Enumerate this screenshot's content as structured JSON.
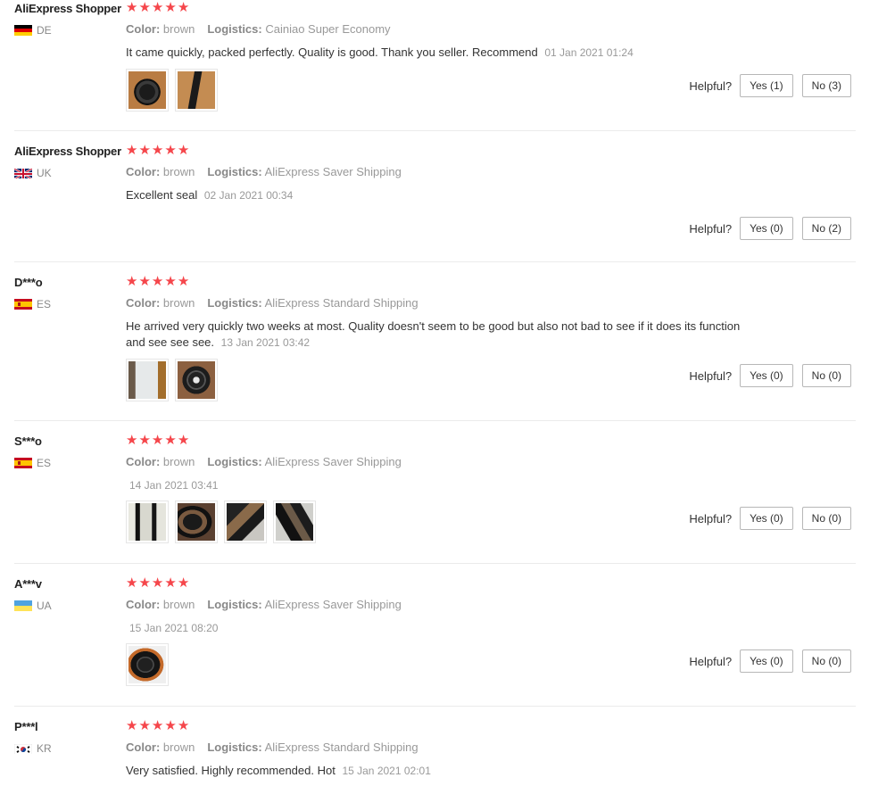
{
  "labels": {
    "color": "Color:",
    "logistics": "Logistics:",
    "helpful": "Helpful?"
  },
  "colors": {
    "star": "#f5464b",
    "text_muted": "#999999"
  },
  "reviews": [
    {
      "user": "AliExpress Shopper",
      "country": "DE",
      "flag": "de-flag-icon",
      "rating": 5,
      "color": "brown",
      "logistics": "Cainiao Super Economy",
      "text": "It came quickly, packed perfectly. Quality is good. Thank you seller. Recommend",
      "date": "01 Jan 2021 01:24",
      "photos": [
        "photo-brown-seal-rolled",
        "photo-brown-seal-strip"
      ],
      "yes": "Yes (1)",
      "no": "No (3)"
    },
    {
      "user": "AliExpress Shopper",
      "country": "UK",
      "flag": "uk-flag-icon",
      "rating": 5,
      "color": "brown",
      "logistics": "AliExpress Saver Shipping",
      "text": "Excellent seal",
      "date": "02 Jan 2021 00:34",
      "photos": [],
      "yes": "Yes (0)",
      "no": "No (2)"
    },
    {
      "user": "D***o",
      "country": "ES",
      "flag": "es-flag-icon",
      "rating": 5,
      "color": "brown",
      "logistics": "AliExpress Standard Shipping",
      "text": "He arrived very quickly two weeks at most. Quality doesn't seem to be good but also not bad to see if it does its function and see see see.",
      "date": "13 Jan 2021 03:42",
      "photos": [
        "photo-package-label",
        "photo-seal-coil"
      ],
      "yes": "Yes (0)",
      "no": "No (0)"
    },
    {
      "user": "S***o",
      "country": "ES",
      "flag": "es-flag-icon",
      "rating": 5,
      "color": "brown",
      "logistics": "AliExpress Saver Shipping",
      "text": "",
      "date": "14 Jan 2021 03:41",
      "photos": [
        "photo-seal-installed-1",
        "photo-seal-installed-2",
        "photo-seal-installed-3",
        "photo-seal-installed-4"
      ],
      "yes": "Yes (0)",
      "no": "No (0)"
    },
    {
      "user": "A***v",
      "country": "UA",
      "flag": "ua-flag-icon",
      "rating": 5,
      "color": "brown",
      "logistics": "AliExpress Saver Shipping",
      "text": "",
      "date": "15 Jan 2021 08:20",
      "photos": [
        "photo-seal-ring"
      ],
      "yes": "Yes (0)",
      "no": "No (0)"
    },
    {
      "user": "P***l",
      "country": "KR",
      "flag": "kr-flag-icon",
      "rating": 5,
      "color": "brown",
      "logistics": "AliExpress Standard Shipping",
      "text": "Very satisfied. Highly recommended. Hot",
      "date": "15 Jan 2021 02:01",
      "photos": [],
      "yes": "",
      "no": ""
    }
  ]
}
